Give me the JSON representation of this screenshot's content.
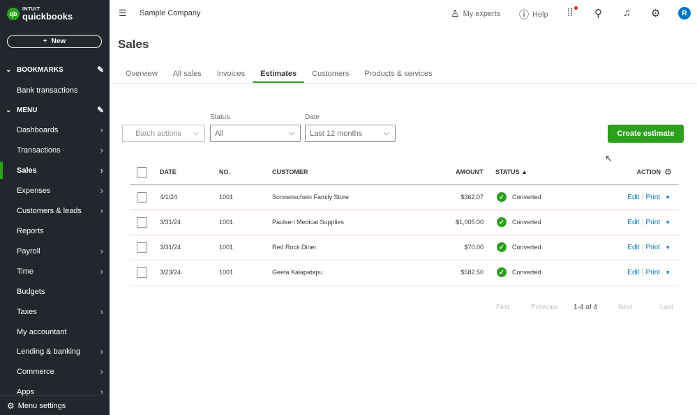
{
  "brand": {
    "logo_mark": "qb",
    "line1": "INTUIT",
    "line2": "quickbooks"
  },
  "sidebar": {
    "new_label": "New",
    "bookmarks_label": "BOOKMARKS",
    "bookmarks": [
      {
        "label": "Bank transactions"
      }
    ],
    "menu_label": "MENU",
    "items": [
      {
        "label": "Dashboards",
        "arrow": true
      },
      {
        "label": "Transactions",
        "arrow": true
      },
      {
        "label": "Sales",
        "arrow": true,
        "active": true
      },
      {
        "label": "Expenses",
        "arrow": true
      },
      {
        "label": "Customers & leads",
        "arrow": true
      },
      {
        "label": "Reports",
        "arrow": false
      },
      {
        "label": "Payroll",
        "arrow": true
      },
      {
        "label": "Time",
        "arrow": true
      },
      {
        "label": "Budgets",
        "arrow": false
      },
      {
        "label": "Taxes",
        "arrow": true
      },
      {
        "label": "My accountant",
        "arrow": false
      },
      {
        "label": "Lending & banking",
        "arrow": true
      },
      {
        "label": "Commerce",
        "arrow": true
      },
      {
        "label": "Apps",
        "arrow": true
      }
    ],
    "menu_settings_label": "Menu settings"
  },
  "topbar": {
    "company": "Sample Company",
    "my_experts": "My experts",
    "help": "Help",
    "avatar_initial": "R"
  },
  "page": {
    "title": "Sales",
    "tabs": [
      {
        "label": "Overview"
      },
      {
        "label": "All sales"
      },
      {
        "label": "Invoices"
      },
      {
        "label": "Estimates",
        "active": true
      },
      {
        "label": "Customers"
      },
      {
        "label": "Products & services"
      }
    ]
  },
  "filters": {
    "batch_actions": "Batch actions",
    "status_label": "Status",
    "status_value": "All",
    "date_label": "Date",
    "date_value": "Last 12 months",
    "create_label": "Create estimate"
  },
  "table": {
    "headers": {
      "date": "DATE",
      "no": "NO.",
      "customer": "CUSTOMER",
      "amount": "AMOUNT",
      "status": "STATUS ▲",
      "action": "ACTION"
    },
    "rows": [
      {
        "date": "4/1/24",
        "no": "1001",
        "customer": "Sonnenschein Family Store",
        "amount": "$362.07",
        "status": "Converted",
        "edit": "Edit",
        "print": "Print"
      },
      {
        "date": "3/31/24",
        "no": "1001",
        "customer": "Paulsen Medical Supplies",
        "amount": "$1,005.00",
        "status": "Converted",
        "edit": "Edit",
        "print": "Print"
      },
      {
        "date": "3/31/24",
        "no": "1001",
        "customer": "Red Rock Diner",
        "amount": "$70.00",
        "status": "Converted",
        "edit": "Edit",
        "print": "Print"
      },
      {
        "date": "3/23/24",
        "no": "1001",
        "customer": "Geeta Kalapatapu",
        "amount": "$582.50",
        "status": "Converted",
        "edit": "Edit",
        "print": "Print"
      }
    ]
  },
  "pagination": {
    "first": "First",
    "previous": "Previous",
    "count": "1-4 of 4",
    "next": "Next",
    "last": "Last"
  },
  "colors": {
    "brand_green": "#2ca01c",
    "sidebar_bg": "#21272c",
    "link_blue": "#0077c5"
  }
}
